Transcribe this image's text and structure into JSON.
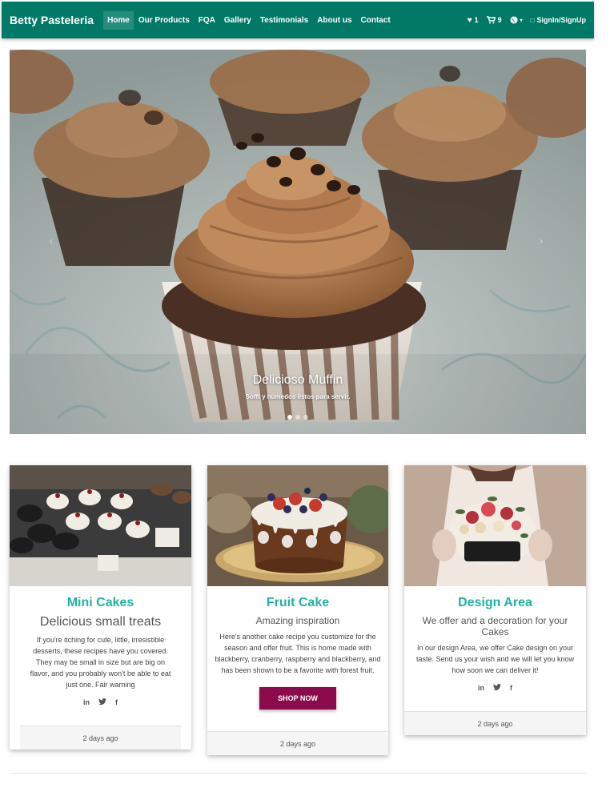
{
  "navbar": {
    "brand": "Betty Pasteleria",
    "links": [
      "Home",
      "Our Products",
      "FQA",
      "Gallery",
      "Testimonials",
      "About us",
      "Contact"
    ],
    "wishlist_count": "1",
    "cart_count": "9",
    "signin_label": "SignIn/SignUp",
    "accent": "#007a67"
  },
  "carousel": {
    "title": "Delicioso Muffin",
    "text": "Sofft y húmedos listos para servir.",
    "slides": 3,
    "active_slide": 1
  },
  "cards": [
    {
      "title": "Mini Cakes",
      "subtitle": "Delicious small treats",
      "text": "If you're itching for cute, little, irresistible desserts, these recipes have you covered. They may be small in size but are big on flavor, and you probably won't be able to eat just one. Fair warning",
      "social": [
        "in",
        "twitter",
        "f"
      ],
      "footer": "2 days ago"
    },
    {
      "title": "Fruit Cake",
      "subtitle": "Amazing inspiration",
      "text": "Here's another cake recipe you customize for the season and offer fruit. This is home made with blackberry, cranberry, raspberry and blackberry, and has been shown to be a favorite with forest fruit.",
      "button": "SHOP NOW",
      "footer": "2 days ago"
    },
    {
      "title": "Design Area",
      "subtitle": "We offer and a decoration for your Cakes",
      "text": "In our design Area, we offer Cake design on your taste. Send us your wish and we will let you know how soon we can deliver it!",
      "social": [
        "in",
        "twitter",
        "f"
      ],
      "footer": "2 days ago"
    }
  ],
  "colors": {
    "title_teal": "#20b2a2",
    "button": "#8b0b4d"
  }
}
